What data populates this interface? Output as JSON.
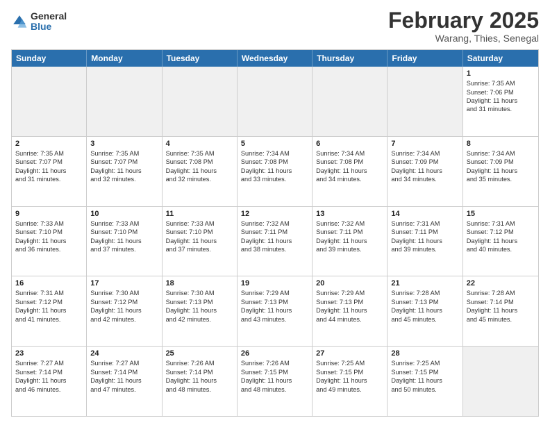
{
  "logo": {
    "general": "General",
    "blue": "Blue"
  },
  "title": "February 2025",
  "subtitle": "Warang, Thies, Senegal",
  "header_days": [
    "Sunday",
    "Monday",
    "Tuesday",
    "Wednesday",
    "Thursday",
    "Friday",
    "Saturday"
  ],
  "rows": [
    [
      {
        "day": "",
        "lines": [],
        "shaded": true
      },
      {
        "day": "",
        "lines": [],
        "shaded": true
      },
      {
        "day": "",
        "lines": [],
        "shaded": true
      },
      {
        "day": "",
        "lines": [],
        "shaded": true
      },
      {
        "day": "",
        "lines": [],
        "shaded": true
      },
      {
        "day": "",
        "lines": [],
        "shaded": true
      },
      {
        "day": "1",
        "lines": [
          "Sunrise: 7:35 AM",
          "Sunset: 7:06 PM",
          "Daylight: 11 hours",
          "and 31 minutes."
        ]
      }
    ],
    [
      {
        "day": "2",
        "lines": [
          "Sunrise: 7:35 AM",
          "Sunset: 7:07 PM",
          "Daylight: 11 hours",
          "and 31 minutes."
        ]
      },
      {
        "day": "3",
        "lines": [
          "Sunrise: 7:35 AM",
          "Sunset: 7:07 PM",
          "Daylight: 11 hours",
          "and 32 minutes."
        ]
      },
      {
        "day": "4",
        "lines": [
          "Sunrise: 7:35 AM",
          "Sunset: 7:08 PM",
          "Daylight: 11 hours",
          "and 32 minutes."
        ]
      },
      {
        "day": "5",
        "lines": [
          "Sunrise: 7:34 AM",
          "Sunset: 7:08 PM",
          "Daylight: 11 hours",
          "and 33 minutes."
        ]
      },
      {
        "day": "6",
        "lines": [
          "Sunrise: 7:34 AM",
          "Sunset: 7:08 PM",
          "Daylight: 11 hours",
          "and 34 minutes."
        ]
      },
      {
        "day": "7",
        "lines": [
          "Sunrise: 7:34 AM",
          "Sunset: 7:09 PM",
          "Daylight: 11 hours",
          "and 34 minutes."
        ]
      },
      {
        "day": "8",
        "lines": [
          "Sunrise: 7:34 AM",
          "Sunset: 7:09 PM",
          "Daylight: 11 hours",
          "and 35 minutes."
        ]
      }
    ],
    [
      {
        "day": "9",
        "lines": [
          "Sunrise: 7:33 AM",
          "Sunset: 7:10 PM",
          "Daylight: 11 hours",
          "and 36 minutes."
        ]
      },
      {
        "day": "10",
        "lines": [
          "Sunrise: 7:33 AM",
          "Sunset: 7:10 PM",
          "Daylight: 11 hours",
          "and 37 minutes."
        ]
      },
      {
        "day": "11",
        "lines": [
          "Sunrise: 7:33 AM",
          "Sunset: 7:10 PM",
          "Daylight: 11 hours",
          "and 37 minutes."
        ]
      },
      {
        "day": "12",
        "lines": [
          "Sunrise: 7:32 AM",
          "Sunset: 7:11 PM",
          "Daylight: 11 hours",
          "and 38 minutes."
        ]
      },
      {
        "day": "13",
        "lines": [
          "Sunrise: 7:32 AM",
          "Sunset: 7:11 PM",
          "Daylight: 11 hours",
          "and 39 minutes."
        ]
      },
      {
        "day": "14",
        "lines": [
          "Sunrise: 7:31 AM",
          "Sunset: 7:11 PM",
          "Daylight: 11 hours",
          "and 39 minutes."
        ]
      },
      {
        "day": "15",
        "lines": [
          "Sunrise: 7:31 AM",
          "Sunset: 7:12 PM",
          "Daylight: 11 hours",
          "and 40 minutes."
        ]
      }
    ],
    [
      {
        "day": "16",
        "lines": [
          "Sunrise: 7:31 AM",
          "Sunset: 7:12 PM",
          "Daylight: 11 hours",
          "and 41 minutes."
        ]
      },
      {
        "day": "17",
        "lines": [
          "Sunrise: 7:30 AM",
          "Sunset: 7:12 PM",
          "Daylight: 11 hours",
          "and 42 minutes."
        ]
      },
      {
        "day": "18",
        "lines": [
          "Sunrise: 7:30 AM",
          "Sunset: 7:13 PM",
          "Daylight: 11 hours",
          "and 42 minutes."
        ]
      },
      {
        "day": "19",
        "lines": [
          "Sunrise: 7:29 AM",
          "Sunset: 7:13 PM",
          "Daylight: 11 hours",
          "and 43 minutes."
        ]
      },
      {
        "day": "20",
        "lines": [
          "Sunrise: 7:29 AM",
          "Sunset: 7:13 PM",
          "Daylight: 11 hours",
          "and 44 minutes."
        ]
      },
      {
        "day": "21",
        "lines": [
          "Sunrise: 7:28 AM",
          "Sunset: 7:13 PM",
          "Daylight: 11 hours",
          "and 45 minutes."
        ]
      },
      {
        "day": "22",
        "lines": [
          "Sunrise: 7:28 AM",
          "Sunset: 7:14 PM",
          "Daylight: 11 hours",
          "and 45 minutes."
        ]
      }
    ],
    [
      {
        "day": "23",
        "lines": [
          "Sunrise: 7:27 AM",
          "Sunset: 7:14 PM",
          "Daylight: 11 hours",
          "and 46 minutes."
        ]
      },
      {
        "day": "24",
        "lines": [
          "Sunrise: 7:27 AM",
          "Sunset: 7:14 PM",
          "Daylight: 11 hours",
          "and 47 minutes."
        ]
      },
      {
        "day": "25",
        "lines": [
          "Sunrise: 7:26 AM",
          "Sunset: 7:14 PM",
          "Daylight: 11 hours",
          "and 48 minutes."
        ]
      },
      {
        "day": "26",
        "lines": [
          "Sunrise: 7:26 AM",
          "Sunset: 7:15 PM",
          "Daylight: 11 hours",
          "and 48 minutes."
        ]
      },
      {
        "day": "27",
        "lines": [
          "Sunrise: 7:25 AM",
          "Sunset: 7:15 PM",
          "Daylight: 11 hours",
          "and 49 minutes."
        ]
      },
      {
        "day": "28",
        "lines": [
          "Sunrise: 7:25 AM",
          "Sunset: 7:15 PM",
          "Daylight: 11 hours",
          "and 50 minutes."
        ]
      },
      {
        "day": "",
        "lines": [],
        "shaded": true
      }
    ]
  ]
}
